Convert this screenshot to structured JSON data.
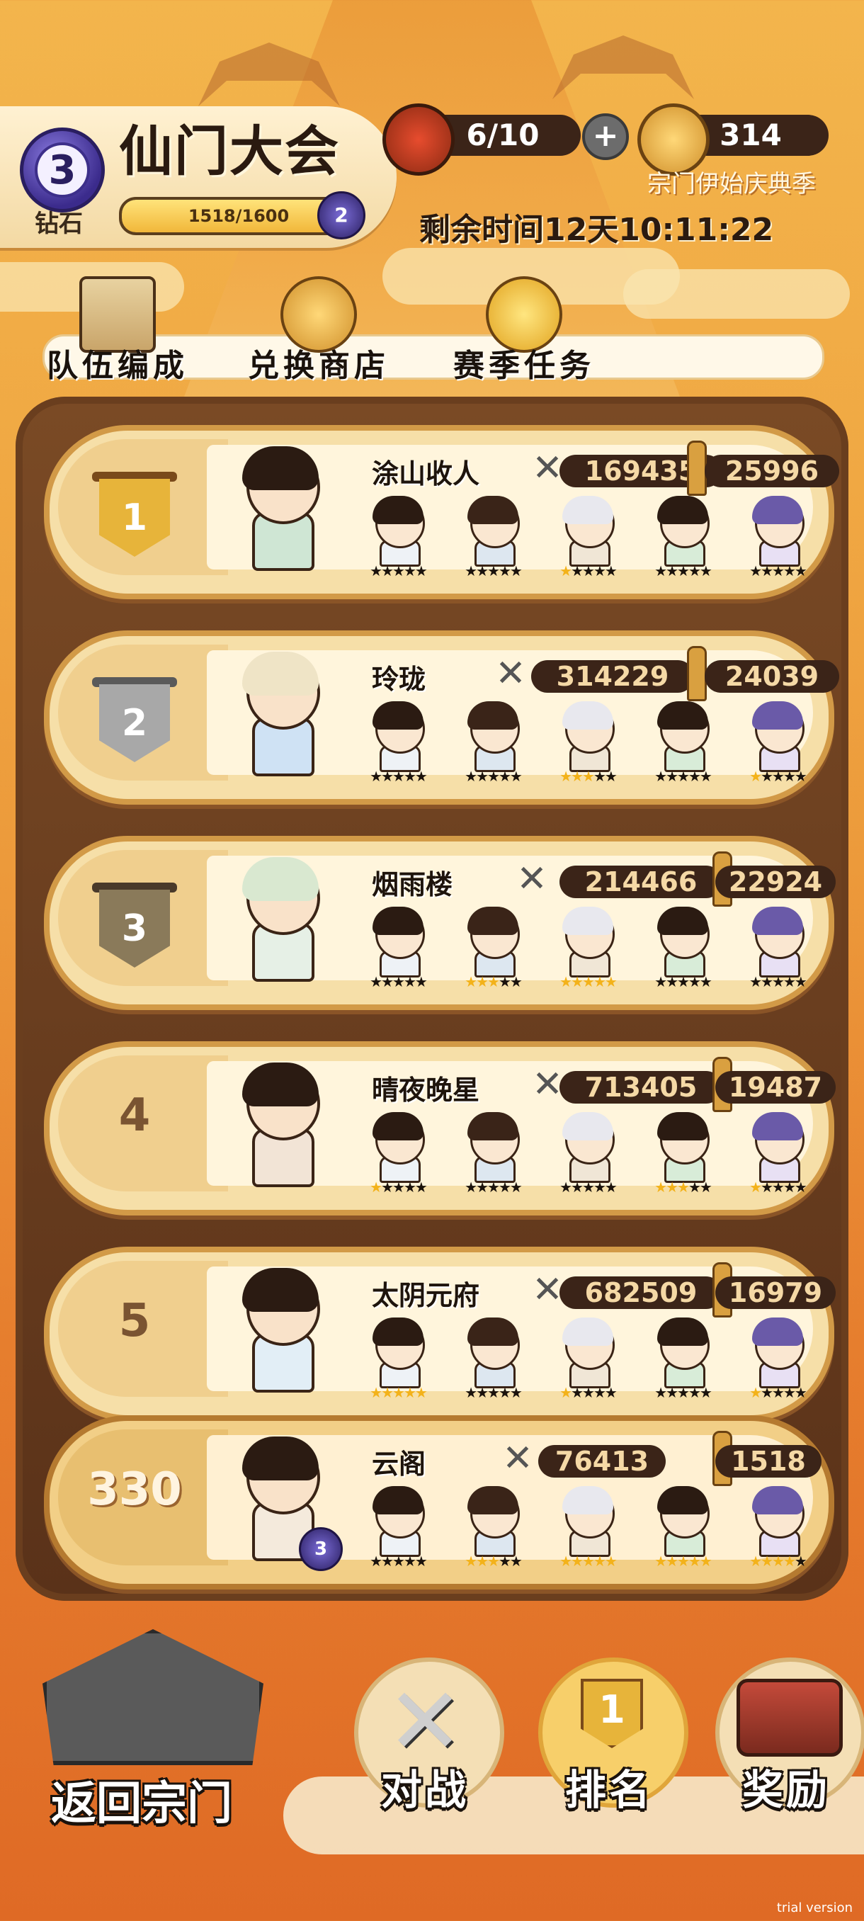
{
  "header": {
    "event_title": "仙门大会",
    "rank_level": "3",
    "rank_tier": "钻石",
    "progress_text": "1518/1600",
    "progress_fraction": 0.949,
    "next_rank_level": "2",
    "tickets": "6/10",
    "currency": "314",
    "season_name": "宗门伊始庆典季",
    "countdown": "剩余时间12天10:11:22"
  },
  "menu": [
    {
      "label": "队伍编成",
      "icon": "scroll-icon"
    },
    {
      "label": "兑换商店",
      "icon": "gourd-icon"
    },
    {
      "label": "赛季任务",
      "icon": "laurel-medal-icon"
    }
  ],
  "leaderboard": [
    {
      "rank": "1",
      "sect": "涂山收人",
      "power": "169435",
      "score": "25996",
      "members": [
        {
          "stars": "★★★★★",
          "gold": 0
        },
        {
          "stars": "★★★★★",
          "gold": 0
        },
        {
          "stars": "★★★★★",
          "gold": 1
        },
        {
          "stars": "★★★★★",
          "gold": 0
        },
        {
          "stars": "★★★★★",
          "gold": 0
        }
      ]
    },
    {
      "rank": "2",
      "sect": "玲珑",
      "power": "314229",
      "score": "24039",
      "members": [
        {
          "stars": "★★★★★",
          "gold": 0
        },
        {
          "stars": "★★★★★",
          "gold": 0
        },
        {
          "stars": "★★★★★",
          "gold": 3
        },
        {
          "stars": "★★★★★",
          "gold": 0
        },
        {
          "stars": "★★★★★",
          "gold": 1
        }
      ]
    },
    {
      "rank": "3",
      "sect": "烟雨楼",
      "power": "214466",
      "score": "22924",
      "members": [
        {
          "stars": "★★★★★",
          "gold": 0
        },
        {
          "stars": "★★★★★",
          "gold": 3
        },
        {
          "stars": "★★★★★",
          "gold": 5
        },
        {
          "stars": "★★★★★",
          "gold": 0
        },
        {
          "stars": "★★★★★",
          "gold": 0
        }
      ]
    },
    {
      "rank": "4",
      "sect": "晴夜晚星",
      "power": "713405",
      "score": "19487",
      "members": [
        {
          "stars": "★★★★★",
          "gold": 1
        },
        {
          "stars": "★★★★★",
          "gold": 0
        },
        {
          "stars": "★★★★★",
          "gold": 0
        },
        {
          "stars": "★★★★★",
          "gold": 3
        },
        {
          "stars": "★★★★★",
          "gold": 1
        }
      ]
    },
    {
      "rank": "5",
      "sect": "太阴元府",
      "power": "682509",
      "score": "16979",
      "members": [
        {
          "stars": "★★★★★",
          "gold": 5
        },
        {
          "stars": "★★★★★",
          "gold": 0
        },
        {
          "stars": "★★★★★",
          "gold": 1
        },
        {
          "stars": "★★★★★",
          "gold": 0
        },
        {
          "stars": "★★★★★",
          "gold": 1
        }
      ]
    }
  ],
  "my_entry": {
    "rank": "330",
    "sect": "云阁",
    "power": "76413",
    "score": "1518",
    "badge_level": "3",
    "members": [
      {
        "stars": "★★★★★",
        "gold": 0
      },
      {
        "stars": "★★★★★",
        "gold": 3
      },
      {
        "stars": "★★★★★",
        "gold": 5
      },
      {
        "stars": "★★★★★",
        "gold": 5
      },
      {
        "stars": "★★★★★",
        "gold": 4
      }
    ]
  },
  "bottom_nav": {
    "back_label": "返回宗门",
    "battle_label": "对战",
    "ranking_label": "排名",
    "ranking_icon_number": "1",
    "reward_label": "奖励"
  },
  "watermark": "trial version",
  "colors": {
    "gold_rank": "#e7b43a",
    "silver_rank": "#a8a8a8",
    "bronze_rank": "#8a7a5a",
    "diamond_purple": "#3b2b8c"
  }
}
